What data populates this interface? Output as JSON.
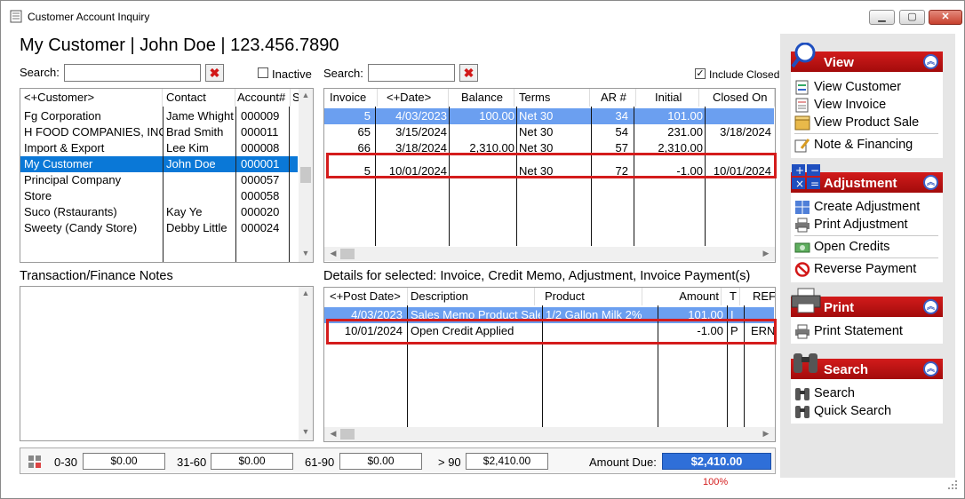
{
  "window": {
    "title": "Customer Account Inquiry"
  },
  "header": {
    "customer_line": "My Customer | John Doe | 123.456.7890"
  },
  "left_search": {
    "label": "Search:",
    "value": "",
    "inactive_label": "Inactive",
    "inactive_checked": false
  },
  "right_search": {
    "label": "Search:",
    "value": "",
    "include_closed_label": "Include Closed",
    "include_closed_checked": true
  },
  "customers": {
    "columns": [
      "<+Customer>",
      "Contact",
      "Account#",
      "S"
    ],
    "rows": [
      {
        "customer": "Fg Corporation",
        "contact": "Jame Whight",
        "account": "000009"
      },
      {
        "customer": "H FOOD COMPANIES, INC",
        "contact": "Brad Smith",
        "account": "000011"
      },
      {
        "customer": "Import & Export",
        "contact": "Lee Kim",
        "account": "000008"
      },
      {
        "customer": "My Customer",
        "contact": "John Doe",
        "account": "000001",
        "selected": true
      },
      {
        "customer": "Principal Company",
        "contact": "",
        "account": "000057"
      },
      {
        "customer": "Store",
        "contact": "",
        "account": "000058"
      },
      {
        "customer": "Suco (Rstaurants)",
        "contact": "Kay Ye",
        "account": "000020"
      },
      {
        "customer": "Sweety (Candy Store)",
        "contact": "Debby Little",
        "account": "000024"
      }
    ]
  },
  "invoices": {
    "columns": [
      "Invoice",
      "<+Date>",
      "Balance",
      "Terms",
      "AR #",
      "Initial",
      "Closed On"
    ],
    "rows": [
      {
        "invoice": "5",
        "date": "4/03/2023",
        "balance": "100.00",
        "terms": "Net 30",
        "ar": "34",
        "initial": "101.00",
        "closed": "",
        "highlight": true
      },
      {
        "invoice": "65",
        "date": "3/15/2024",
        "balance": "",
        "terms": "Net 30",
        "ar": "54",
        "initial": "231.00",
        "closed": "3/18/2024"
      },
      {
        "invoice": "66",
        "date": "3/18/2024",
        "balance": "2,310.00",
        "terms": "Net 30",
        "ar": "57",
        "initial": "2,310.00",
        "closed": ""
      },
      {
        "invoice": "5",
        "date": "10/01/2024",
        "balance": "",
        "terms": "Net 30",
        "ar": "72",
        "initial": "-1.00",
        "closed": "10/01/2024",
        "boxed": true
      }
    ]
  },
  "notes": {
    "title": "Transaction/Finance Notes"
  },
  "details": {
    "title": "Details for selected: Invoice, Credit Memo, Adjustment, Invoice Payment(s)",
    "columns": [
      "<+Post Date>",
      "Description",
      "Product",
      "Amount",
      "T",
      "REF"
    ],
    "rows": [
      {
        "post_date": "4/03/2023",
        "description": "Sales Memo Product Sale",
        "product": "1/2 Gallon Milk 2%",
        "amount": "101.00",
        "t": "I",
        "ref": "",
        "highlight": true
      },
      {
        "post_date": "10/01/2024",
        "description": "Open Credit Applied",
        "product": "",
        "amount": "-1.00",
        "t": "P",
        "ref": "ERN",
        "boxed": true
      }
    ]
  },
  "aging": {
    "b0_30_label": "0-30",
    "b0_30": "$0.00",
    "b31_60_label": "31-60",
    "b31_60": "$0.00",
    "b61_90_label": "61-90",
    "b61_90": "$0.00",
    "b90_label": "> 90",
    "b90": "$2,410.00",
    "amount_due_label": "Amount Due:",
    "amount_due": "$2,410.00",
    "percent": "100%"
  },
  "sidebar": {
    "view": {
      "title": "View",
      "items": [
        "View Customer",
        "View Invoice",
        "View Product Sale",
        "Note & Financing"
      ]
    },
    "adjustment": {
      "title": "Adjustment",
      "items": [
        "Create Adjustment",
        "Print Adjustment",
        "Open Credits",
        "Reverse Payment"
      ]
    },
    "print": {
      "title": "Print",
      "items": [
        "Print Statement"
      ]
    },
    "search": {
      "title": "Search",
      "items": [
        "Search",
        "Quick Search"
      ]
    }
  },
  "colors": {
    "selection": "#0a78d7",
    "highlight_row": "#6b9ff0",
    "panel_red": "#c41212",
    "callout_red": "#d41c1c",
    "amount_due_bg": "#2f6fd8"
  }
}
